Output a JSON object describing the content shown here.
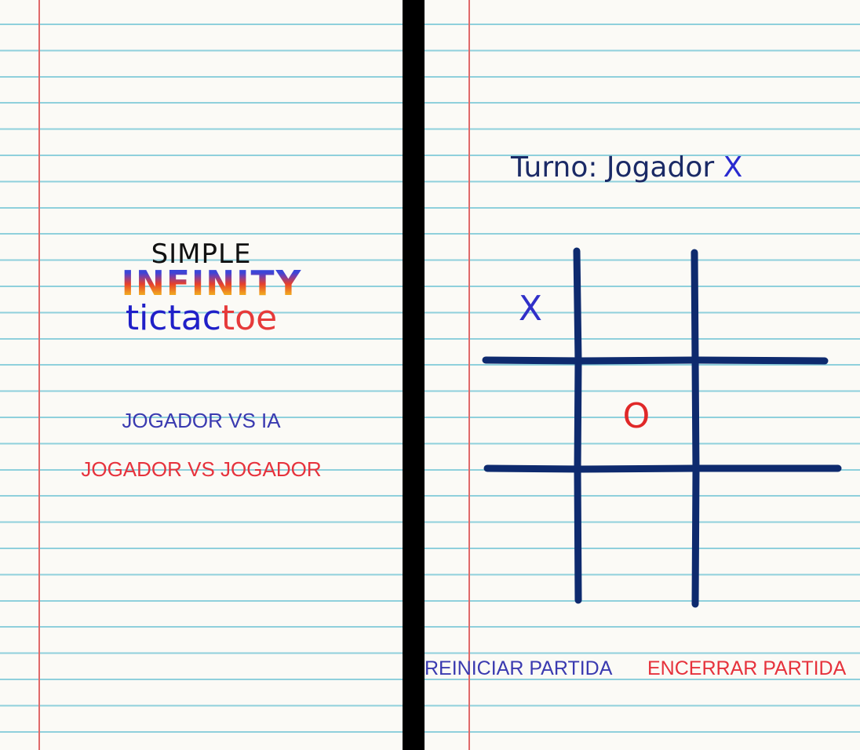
{
  "menu": {
    "logo": {
      "line1": "SIMPLE",
      "line2": "INFINITY",
      "line3_part1": "tictac",
      "line3_part2": "toe"
    },
    "buttons": {
      "player_vs_ai": "JOGADOR VS IA",
      "player_vs_player": "JOGADOR VS JOGADOR"
    }
  },
  "game": {
    "turn_label": "Turno: Jogador ",
    "turn_player": "X",
    "board": [
      "X",
      "",
      "",
      "",
      "O",
      "",
      "",
      "",
      ""
    ],
    "buttons": {
      "restart": "REINICIAR PARTIDA",
      "end": "ENCERRAR PARTIDA"
    }
  },
  "colors": {
    "grid": "#0e2a6e",
    "x_mark": "#3030c8",
    "o_mark": "#e02828",
    "paper_line": "#8fd0dc",
    "margin_line": "#e06a6a"
  }
}
